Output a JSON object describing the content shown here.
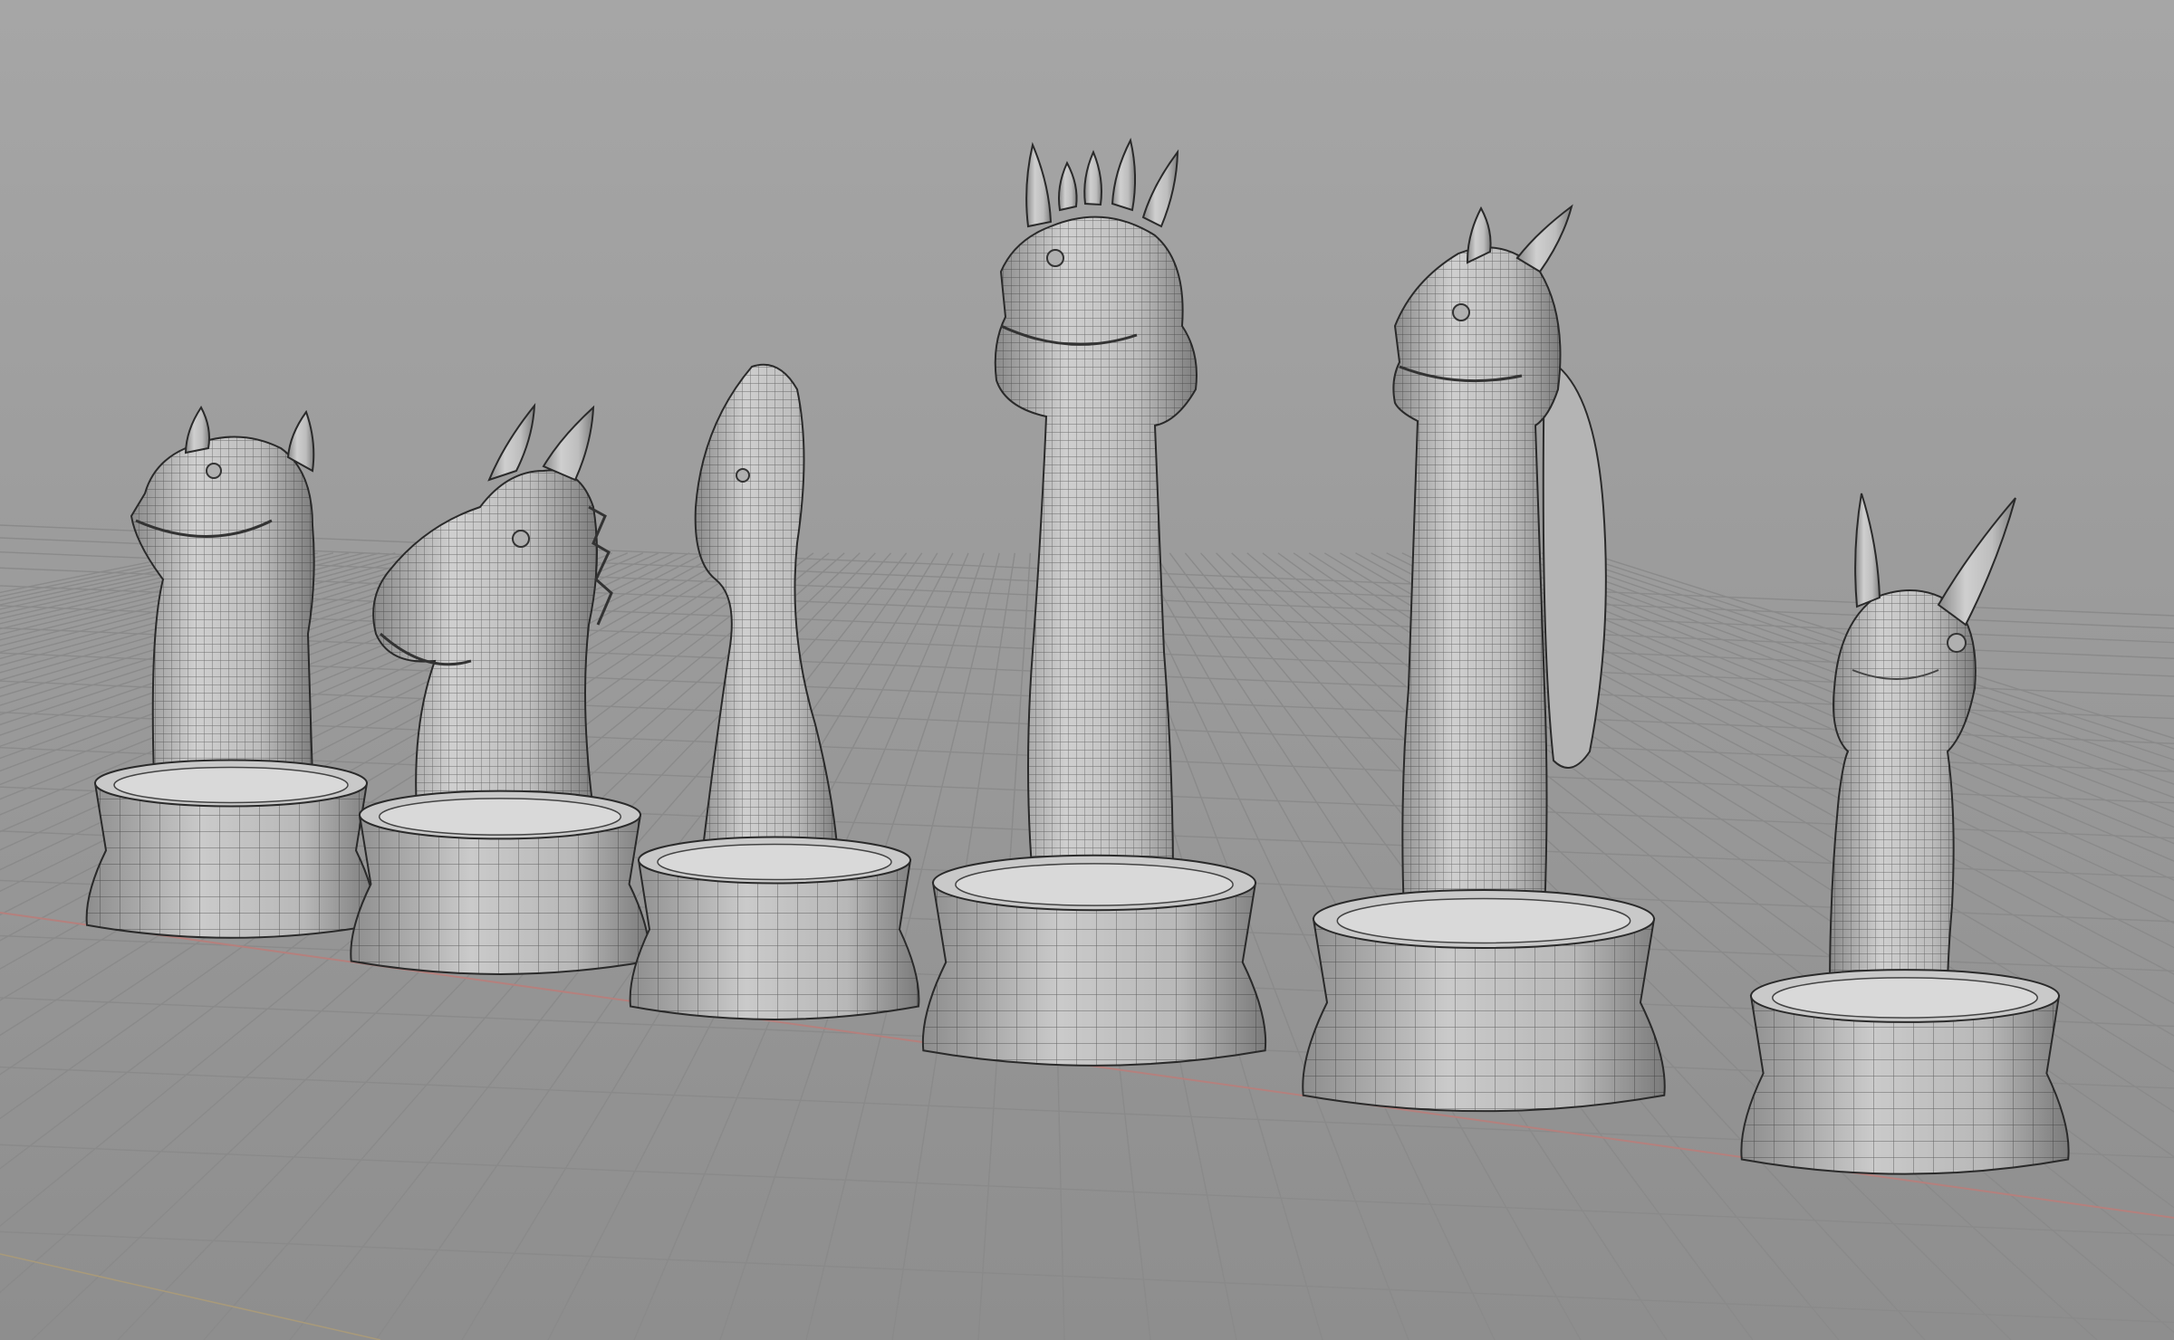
{
  "viewport": {
    "background_top": "#a5a5a5",
    "background_bottom": "#8f8f8f",
    "grid_color": "#858585",
    "x_axis_color": "#b77a78",
    "mesh_fill": "#c6c6c6",
    "mesh_shade": "#7a7a7a",
    "wire_color": "#1a1a1a"
  },
  "scene": {
    "pieces": [
      {
        "id": "pawn-dragon",
        "kind": "horned-head"
      },
      {
        "id": "knight-dragon",
        "kind": "horse-dragon"
      },
      {
        "id": "bishop-dragon",
        "kind": "mitre-head"
      },
      {
        "id": "king-dragon",
        "kind": "crowned-head"
      },
      {
        "id": "queen-dragon",
        "kind": "horned-head-with-wing"
      },
      {
        "id": "rook-dragon",
        "kind": "small-horned-head"
      }
    ]
  }
}
